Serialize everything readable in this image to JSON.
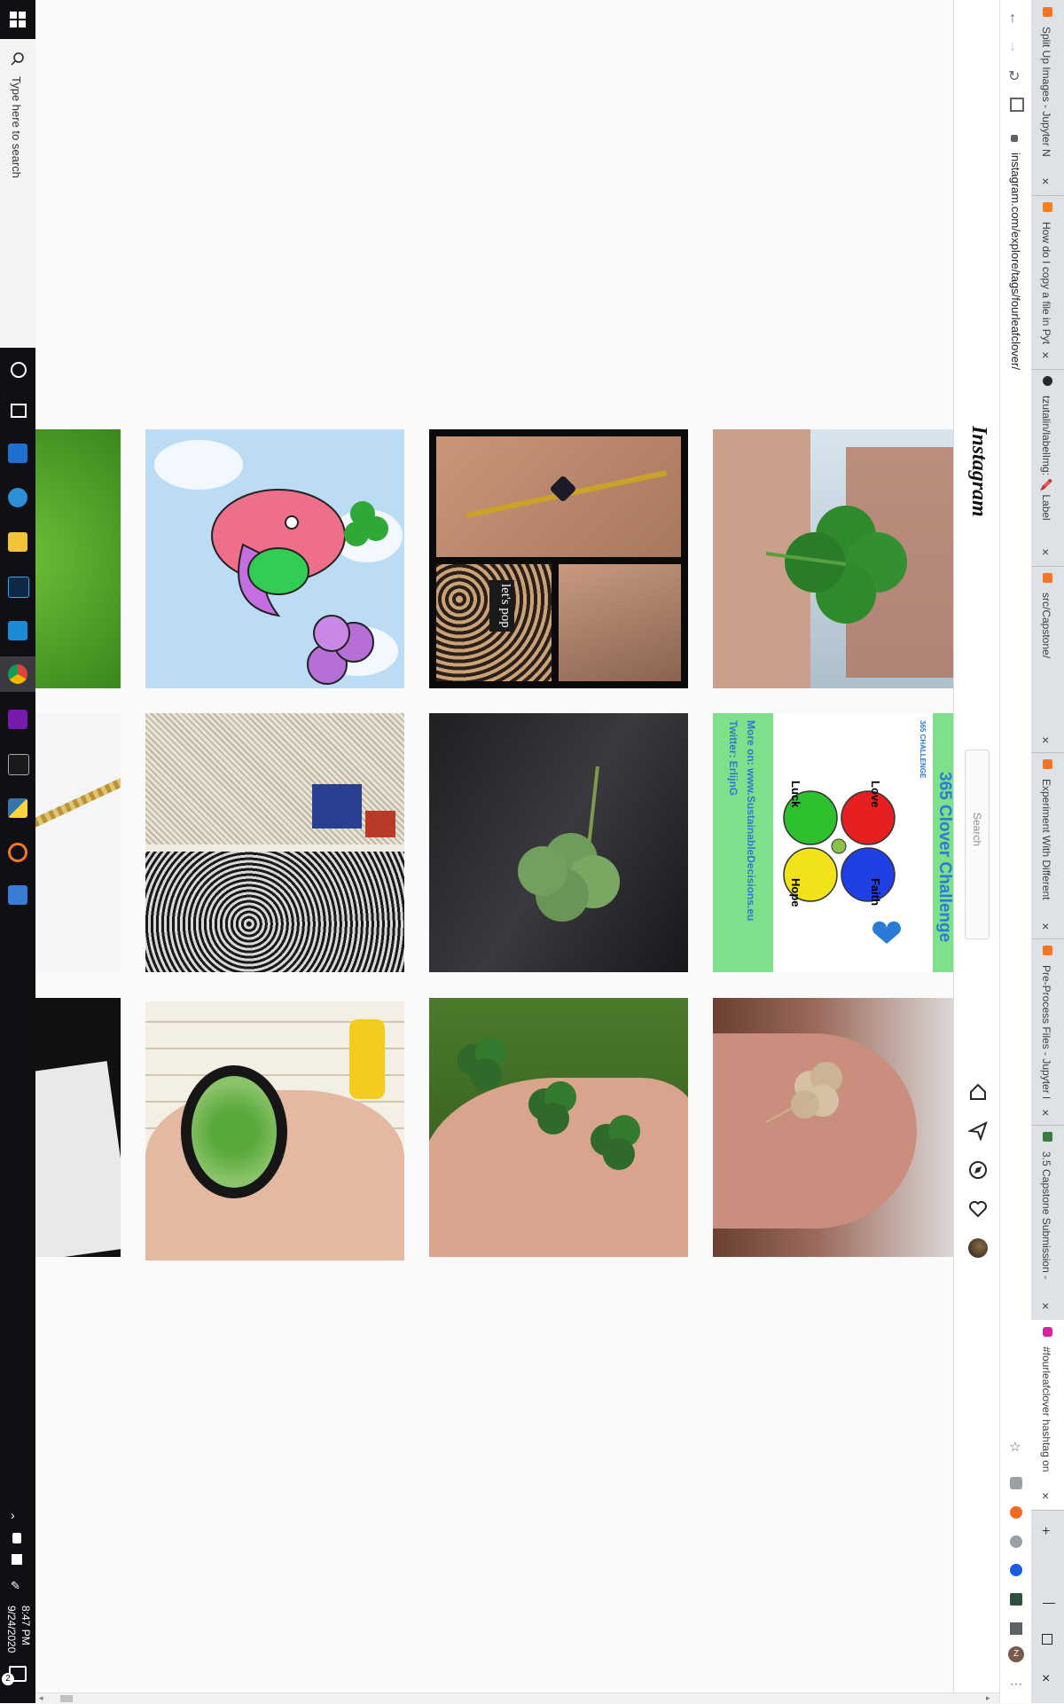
{
  "taskbar": {
    "search_placeholder": "Type here to search",
    "clock_time": "8:47 PM",
    "clock_date": "9/24/2020",
    "notification_count": "2",
    "icons": [
      "windows-start-icon",
      "search-icon",
      "cortana-icon",
      "task-view-icon",
      "store-icon",
      "edge-icon",
      "file-explorer-icon",
      "photoshop-icon",
      "vscode-icon",
      "chrome-icon",
      "onenote-icon",
      "terminal-icon",
      "python-icon",
      "jupyter-icon",
      "calculator-icon"
    ]
  },
  "browser": {
    "url": "instagram.com/explore/tags/fourleafclover/",
    "tabs": [
      {
        "label": "Split Up Images - Jupyter N",
        "favicon_color": "#f37626"
      },
      {
        "label": "How do I copy a file in Pyth",
        "favicon_color": "#f48024"
      },
      {
        "label": "tzutalin/labelImg: 🖍️ Label",
        "favicon_color": "#24292e"
      },
      {
        "label": "src/Capstone/",
        "favicon_color": "#f37626"
      },
      {
        "label": "Experiment With Different",
        "favicon_color": "#f37626"
      },
      {
        "label": "Pre-Process Files - Jupyter N",
        "favicon_color": "#f37626"
      },
      {
        "label": "3.5 Capstone Submission -",
        "favicon_color": "#3b7b3b"
      },
      {
        "label": "#fourleafclover hashtag on",
        "favicon_color": "#d6249f",
        "active": true
      }
    ],
    "extension_icons": [
      "star-icon",
      "grammarly-icon",
      "ublock-icon",
      "ghostery-icon",
      "bitwarden-icon",
      "tag-assistant-icon",
      "extensions-puzzle-icon",
      "profile-z-icon"
    ],
    "profile_letter": "Z"
  },
  "instagram": {
    "logo": "Instagram",
    "search_placeholder": "Search",
    "nav_icons": [
      "home-icon",
      "direct-message-icon",
      "explore-compass-icon",
      "activity-heart-icon",
      "profile-avatar-icon"
    ]
  },
  "posts": {
    "row1": [
      {
        "kind": "grass"
      },
      {
        "kind": "bird-illustration"
      },
      {
        "kind": "bracelet-collage",
        "card_text": "let's pop"
      },
      {
        "kind": "clover-held-sky"
      }
    ],
    "row2": [
      {
        "kind": "chain"
      },
      {
        "kind": "sketch"
      },
      {
        "kind": "clover-on-wood"
      },
      {
        "kind": "challenge-poster",
        "title": "365 Clover Challenge",
        "badge": "365 CHALLENGE",
        "words": [
          "Love",
          "Faith",
          "Hope",
          "Luck"
        ],
        "footer1": "More on: www.SustainableDecisions.eu",
        "footer2": "Twitter: ErlijnG"
      }
    ],
    "row3": [
      {
        "kind": "paper"
      },
      {
        "kind": "pendant"
      },
      {
        "kind": "clovers-on-fingers"
      },
      {
        "kind": "dried-clover-hand"
      }
    ]
  }
}
